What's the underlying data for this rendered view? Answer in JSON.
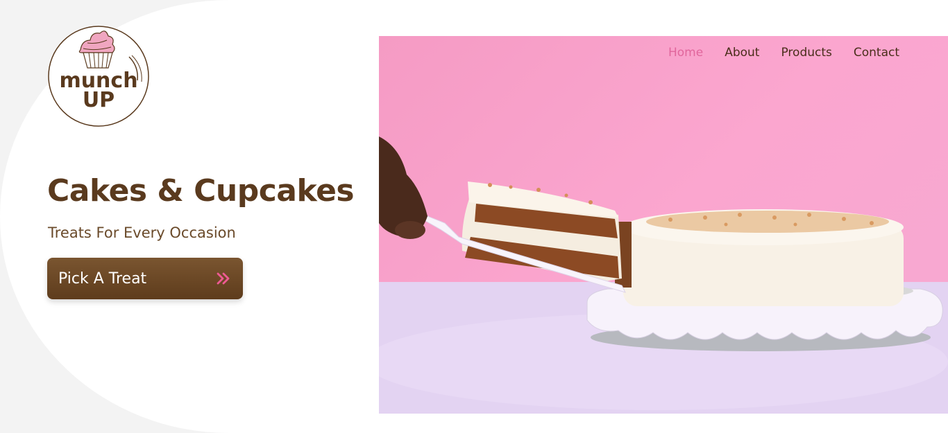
{
  "brand": {
    "logo_line1": "munch",
    "logo_line2": "UP"
  },
  "nav": {
    "items": [
      {
        "label": "Home",
        "active": true
      },
      {
        "label": "About",
        "active": false
      },
      {
        "label": "Products",
        "active": false
      },
      {
        "label": "Contact",
        "active": false
      }
    ]
  },
  "hero": {
    "title": "Cakes & Cupcakes",
    "subtitle": "Treats For Every Occasion",
    "cta_label": "Pick A Treat",
    "cta_icon": "double-chevron-right-icon"
  },
  "colors": {
    "brown": "#5a3a1e",
    "pink_accent": "#e1669c",
    "photo_bg": "#f9a3cb"
  }
}
